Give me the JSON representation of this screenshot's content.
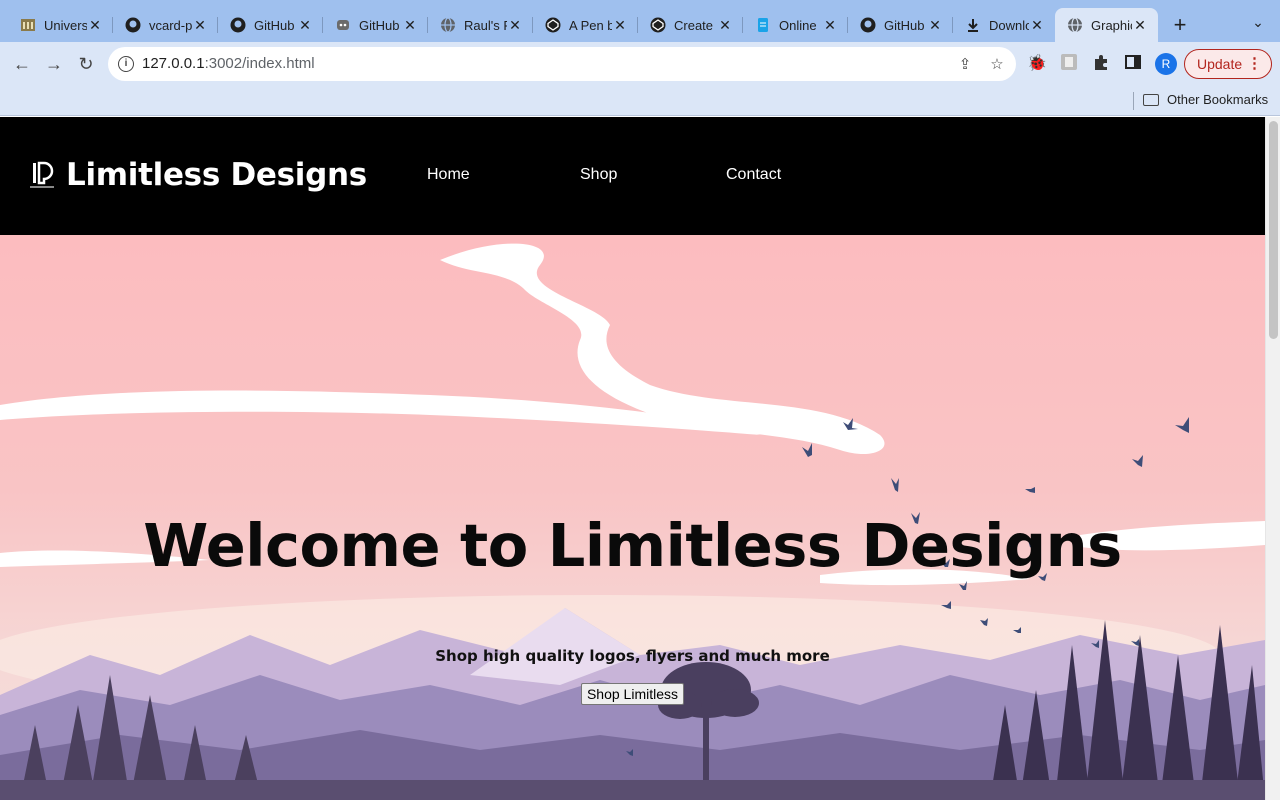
{
  "browser": {
    "tabs": [
      {
        "title": "Univers",
        "icon": "university-icon"
      },
      {
        "title": "vcard-p",
        "icon": "github-icon"
      },
      {
        "title": "GitHub",
        "icon": "github-icon"
      },
      {
        "title": "GitHub",
        "icon": "github-cat-icon"
      },
      {
        "title": "Raul's P",
        "icon": "globe-icon"
      },
      {
        "title": "A Pen b",
        "icon": "codepen-icon"
      },
      {
        "title": "Create",
        "icon": "codepen-icon"
      },
      {
        "title": "Online",
        "icon": "document-icon"
      },
      {
        "title": "GitHub",
        "icon": "github-icon"
      },
      {
        "title": "Downlo",
        "icon": "download-icon"
      },
      {
        "title": "Graphic",
        "icon": "globe-icon",
        "active": true
      }
    ],
    "url_host": "127.0.0.1",
    "url_rest": ":3002/index.html",
    "update_label": "Update",
    "profile_initial": "R",
    "bookmark_other": "Other Bookmarks"
  },
  "site": {
    "brand": "Limitless Designs",
    "nav": [
      "Home",
      "Shop",
      "Contact"
    ],
    "hero_title": "Welcome to Limitless Designs",
    "hero_subtitle": "Shop high quality logos, flyers and much more",
    "hero_button": "Shop Limitless"
  },
  "colors": {
    "header_bg": "#000000",
    "sky_top": "#fcbcbf",
    "sky_bottom": "#f6d7d5",
    "mountain_far": "#b7a6cf",
    "mountain_mid": "#8e7fb0",
    "forest_dark": "#3f3551",
    "birds": "#3e4d78"
  }
}
